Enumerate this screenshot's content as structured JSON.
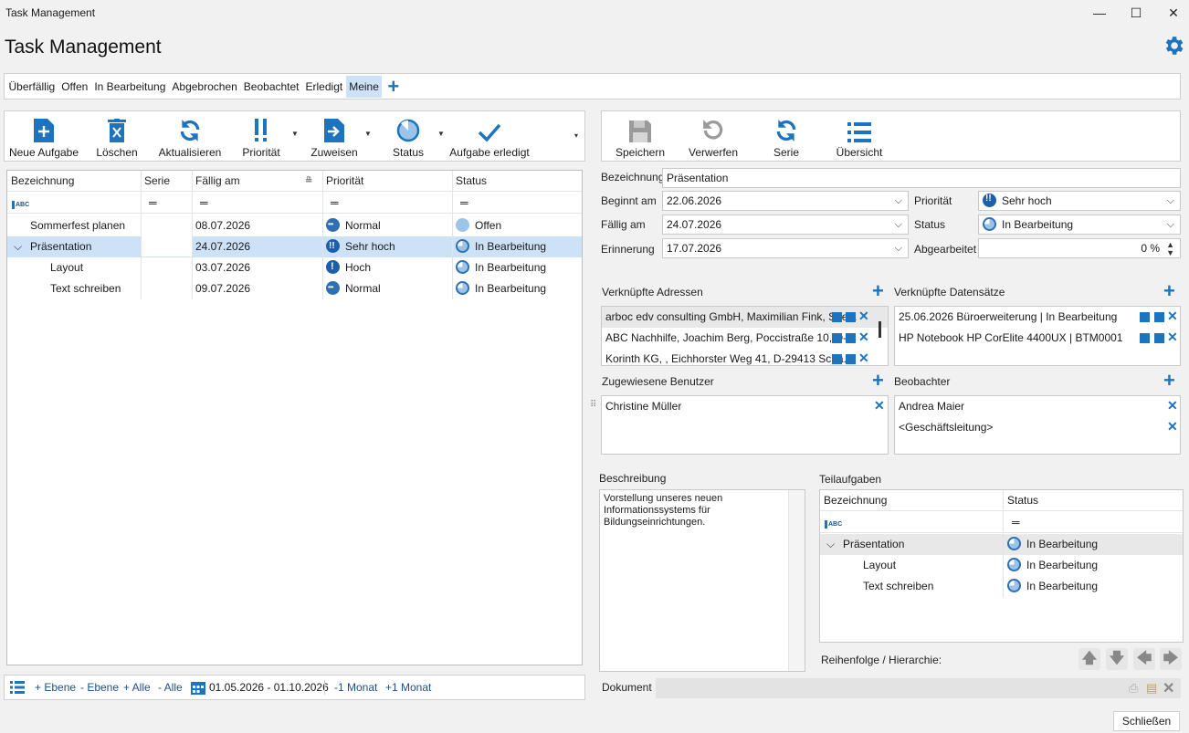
{
  "window": {
    "title": "Task Management",
    "minimize": "—",
    "maximize": "☐",
    "close": "✕"
  },
  "app": {
    "title": "Task Management"
  },
  "filters": [
    "Überfällig",
    "Offen",
    "In Bearbeitung",
    "Abgebrochen",
    "Beobachtet",
    "Erledigt",
    "Meine"
  ],
  "left_toolbar": {
    "new": "Neue Aufgabe",
    "delete": "Löschen",
    "refresh": "Aktualisieren",
    "priority": "Priorität",
    "assign": "Zuweisen",
    "status": "Status",
    "done": "Aufgabe erledigt"
  },
  "right_toolbar": {
    "save": "Speichern",
    "discard": "Verwerfen",
    "series": "Serie",
    "overview": "Übersicht"
  },
  "grid": {
    "headers": [
      "Bezeichnung",
      "Serie",
      "Fällig am",
      "Priorität",
      "Status"
    ],
    "filter_eq": "═",
    "rows": [
      {
        "name": "Sommerfest planen",
        "series": "",
        "due": "08.07.2026",
        "priority": "Normal",
        "status": "Offen"
      },
      {
        "name": "Präsentation",
        "series": "",
        "due": "24.07.2026",
        "priority": "Sehr hoch",
        "status": "In Bearbeitung"
      },
      {
        "name": "Layout",
        "series": "",
        "due": "03.07.2026",
        "priority": "Hoch",
        "status": "In Bearbeitung"
      },
      {
        "name": "Text schreiben",
        "series": "",
        "due": "09.07.2026",
        "priority": "Normal",
        "status": "In Bearbeitung"
      }
    ]
  },
  "bottom": {
    "plus_level": "+ Ebene",
    "minus_level": "- Ebene",
    "plus_all": "+ Alle",
    "minus_all": "- Alle",
    "range": "01.05.2026 - 01.10.2026",
    "minus_month": "-1 Monat",
    "plus_month": "+1 Monat"
  },
  "detail": {
    "name_label": "Bezeichnung",
    "name": "Präsentation",
    "start_label": "Beginnt am",
    "start": "22.06.2026",
    "due_label": "Fällig am",
    "due": "24.07.2026",
    "reminder_label": "Erinnerung",
    "reminder": "17.07.2026",
    "priority_label": "Priorität",
    "priority": "Sehr hoch",
    "status_label": "Status",
    "status": "In Bearbeitung",
    "progress_label": "Abgearbeitet",
    "progress": "0 %",
    "addresses_label": "Verknüpfte Adressen",
    "addresses": [
      "arboc edv consulting GmbH, Maximilian Fink, See...",
      "ABC Nachhilfe, Joachim Berg, Poccistraße 10, D-...",
      "Korinth KG, , Eichhorster Weg 41, D-29413 Scha..."
    ],
    "records_label": "Verknüpfte Datensätze",
    "records": [
      "25.06.2026 Büroerweiterung | In Bearbeitung",
      "HP Notebook HP CorElite 4400UX | BTM0001"
    ],
    "users_label": "Zugewiesene Benutzer",
    "users": [
      "Christine Müller"
    ],
    "observers_label": "Beobachter",
    "observers": [
      "Andrea Maier",
      "<Geschäftsleitung>"
    ],
    "desc_label": "Beschreibung",
    "desc": "Vorstellung unseres neuen Informationssystems für Bildungseinrichtungen.",
    "subtasks_label": "Teilaufgaben",
    "subtasks_headers": [
      "Bezeichnung",
      "Status"
    ],
    "subtasks": [
      {
        "name": "Präsentation",
        "status": "In Bearbeitung"
      },
      {
        "name": "Layout",
        "status": "In Bearbeitung"
      },
      {
        "name": "Text schreiben",
        "status": "In Bearbeitung"
      }
    ],
    "order_label": "Reihenfolge / Hierarchie:",
    "doc_label": "Dokument"
  },
  "close_button": "Schließen",
  "colors": {
    "accent": "#1e73be",
    "selection": "#cde2f7"
  }
}
